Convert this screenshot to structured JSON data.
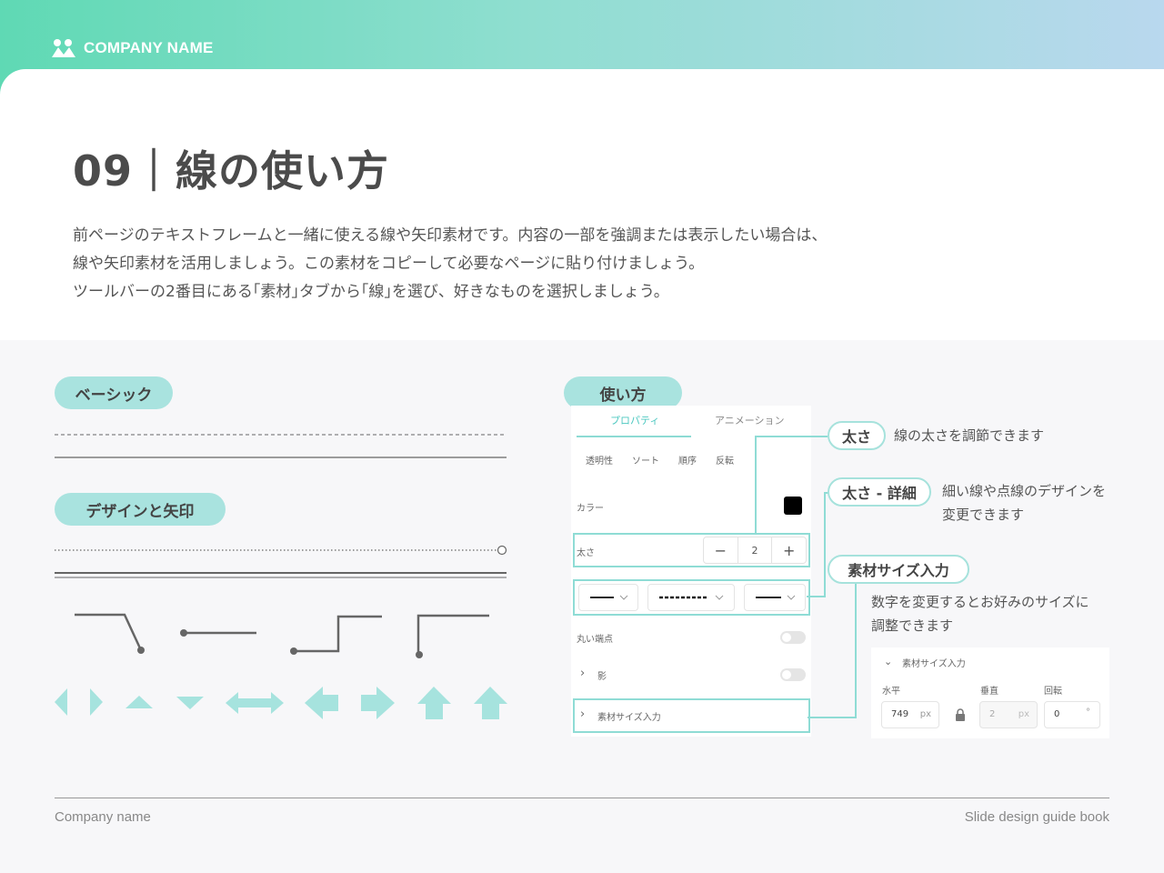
{
  "header": {
    "brand_name": "COMPANY NAME"
  },
  "title": "09｜線の使い方",
  "intro": [
    "前ページのテキストフレームと一緒に使える線や矢印素材です。内容の一部を強調または表示したい場合は、",
    "線や矢印素材を活用しましょう。この素材をコピーして必要なページに貼り付けましょう。",
    "ツールバーの2番目にある｢素材｣タブから｢線｣を選び、好きなものを選択しましょう。"
  ],
  "sections": {
    "basic": "ベーシック",
    "design_arrows": "デザインと矢印",
    "howto": "使い方"
  },
  "panel": {
    "tab_props": "プロパティ",
    "tab_anim": "アニメーション",
    "row_opts": [
      "透明性",
      "ソート",
      "順序",
      "反転"
    ],
    "color_label": "カラー",
    "weight_label": "太さ",
    "weight_value": "2",
    "round_label": "丸い端点",
    "shadow_label": "影",
    "size_label": "素材サイズ入力"
  },
  "callouts": {
    "weight": {
      "label": "太さ",
      "note": "線の太さを調節できます"
    },
    "weight_detail": {
      "label": "太さ - 詳細",
      "note1": "細い線や点線のデザインを",
      "note2": "変更できます"
    },
    "size": {
      "label": "素材サイズ入力",
      "note1": "数字を変更するとお好みのサイズに",
      "note2": "調整できます"
    }
  },
  "size_panel": {
    "heading": "素材サイズ入力",
    "h_label": "水平",
    "v_label": "垂直",
    "r_label": "回転",
    "h_value": "749",
    "v_value": "2",
    "r_value": "0",
    "unit": "px"
  },
  "colors": {
    "accent": "#a9e3df",
    "line": "#8fdcd5",
    "arrow": "#a6e3de"
  },
  "footer": {
    "left": "Company name",
    "right": "Slide design guide book"
  }
}
